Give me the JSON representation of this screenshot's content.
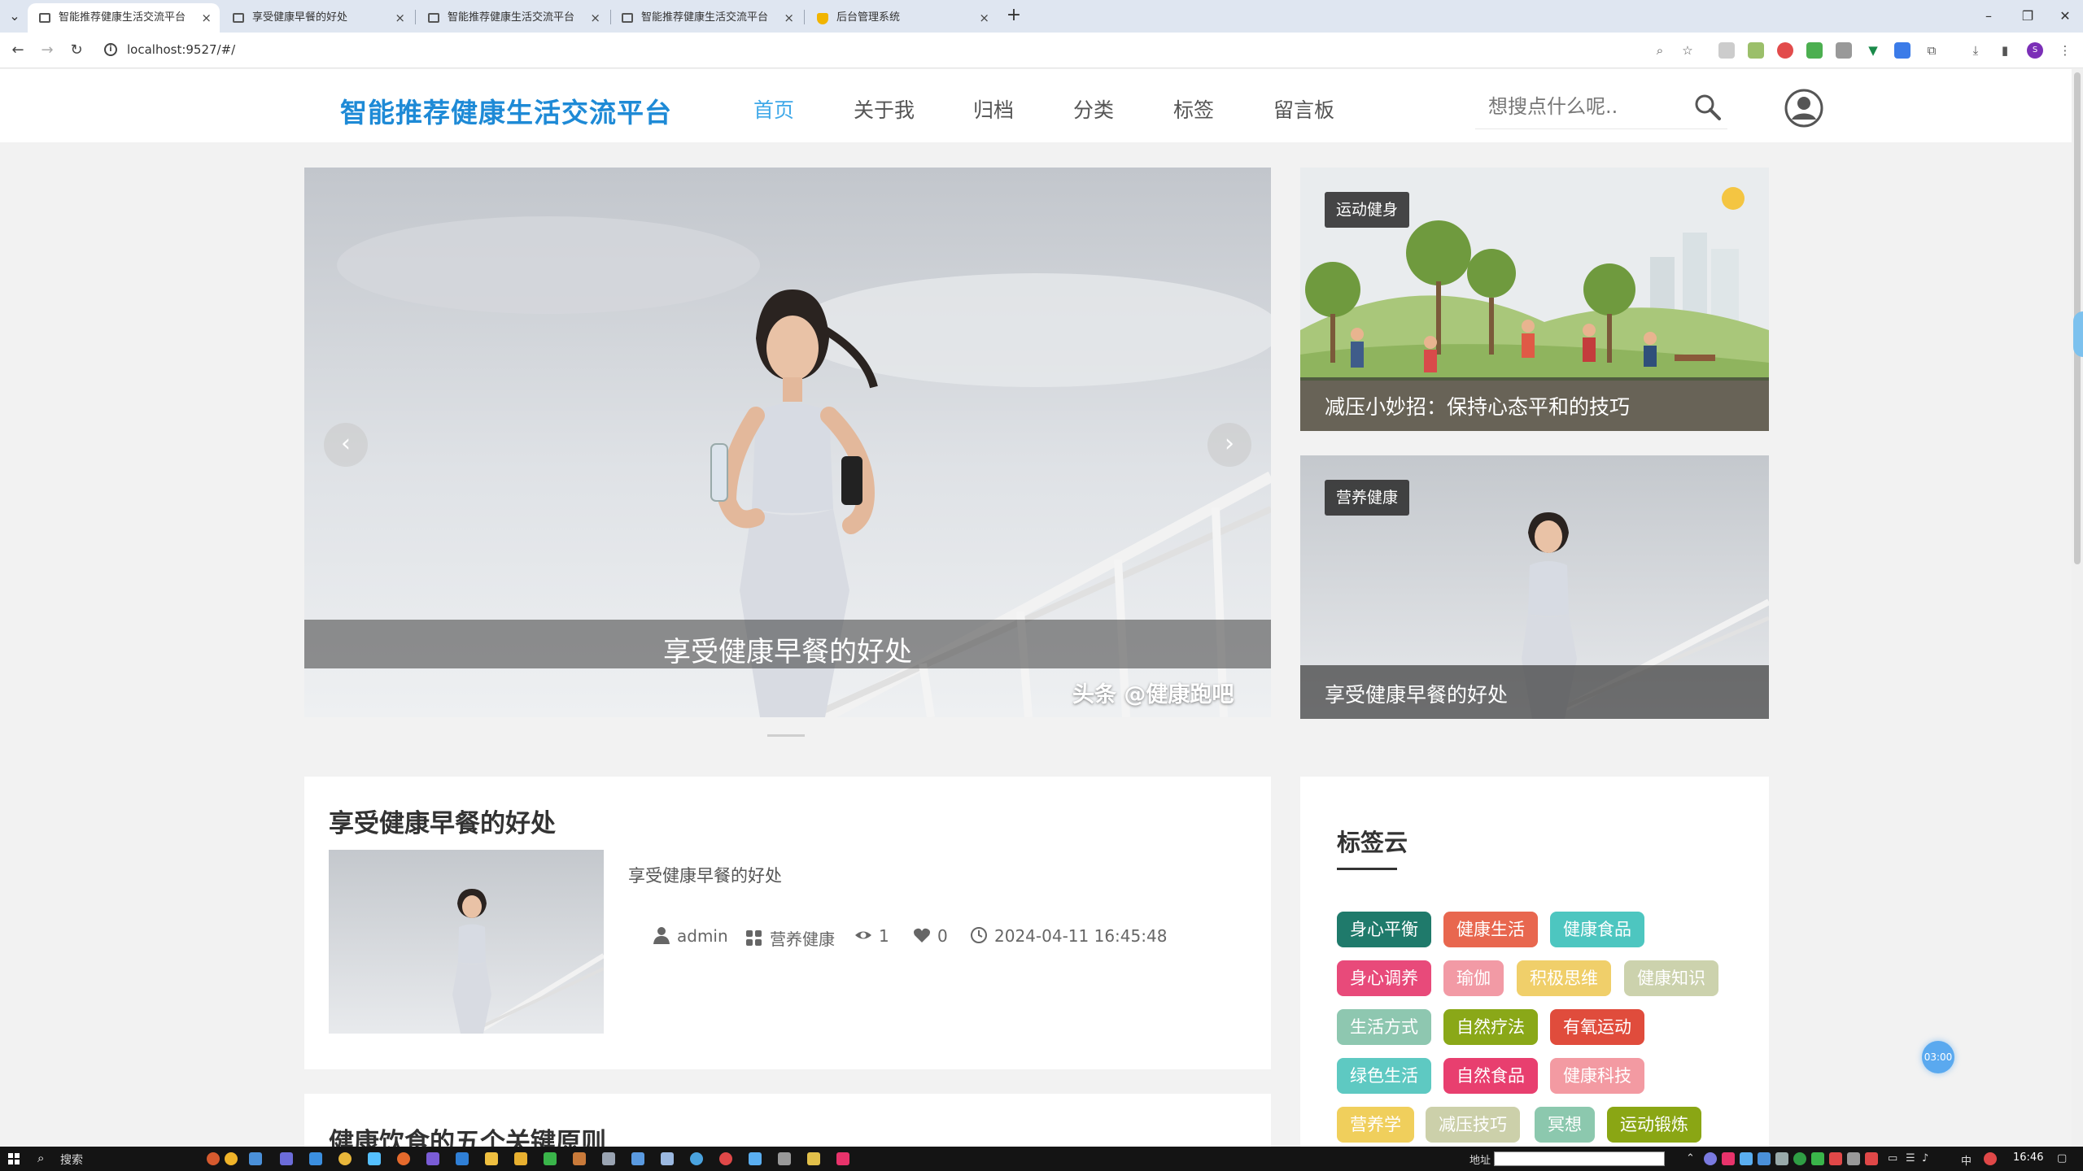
{
  "browser": {
    "tabs": [
      {
        "title": "智能推荐健康生活交流平台",
        "active": true
      },
      {
        "title": "享受健康早餐的好处",
        "active": false
      },
      {
        "title": "智能推荐健康生活交流平台",
        "active": false
      },
      {
        "title": "智能推荐健康生活交流平台",
        "active": false
      },
      {
        "title": "后台管理系统",
        "active": false
      }
    ],
    "url": "localhost:9527/#/",
    "profile_initial": "S"
  },
  "site": {
    "logo": "智能推荐健康生活交流平台",
    "nav": [
      "首页",
      "关于我",
      "归档",
      "分类",
      "标签",
      "留言板"
    ],
    "active_nav": "首页",
    "search_placeholder": "想搜点什么呢.."
  },
  "hero": {
    "caption": "享受健康早餐的好处",
    "watermark": "头条 @健康跑吧",
    "prev_glyph": "‹",
    "next_glyph": "›"
  },
  "side_cards": [
    {
      "category": "运动健身",
      "title": "减压小妙招：保持心态平和的技巧"
    },
    {
      "category": "营养健康",
      "title": "享受健康早餐的好处"
    }
  ],
  "articles": [
    {
      "title": "享受健康早餐的好处",
      "summary": "享受健康早餐的好处",
      "author": "admin",
      "category": "营养健康",
      "views": "1",
      "likes": "0",
      "date": "2024-04-11 16:45:48"
    },
    {
      "title": "健康饮食的五个关键原则"
    }
  ],
  "tag_cloud": {
    "title": "标签云",
    "tags": [
      {
        "label": "身心平衡",
        "color": "#1f7a6b"
      },
      {
        "label": "健康生活",
        "color": "#e8674f"
      },
      {
        "label": "健康食品",
        "color": "#4dc6c0"
      },
      {
        "label": "身心调养",
        "color": "#e84a7a"
      },
      {
        "label": "瑜伽",
        "color": "#f29aa5"
      },
      {
        "label": "积极思维",
        "color": "#f0cf6a"
      },
      {
        "label": "健康知识",
        "color": "#ccd2ad"
      },
      {
        "label": "生活方式",
        "color": "#8ec7b0"
      },
      {
        "label": "自然疗法",
        "color": "#8aa818"
      },
      {
        "label": "有氧运动",
        "color": "#e04c3c"
      },
      {
        "label": "绿色生活",
        "color": "#5ec9c2"
      },
      {
        "label": "自然食品",
        "color": "#e83f6f"
      },
      {
        "label": "健康科技",
        "color": "#f39aa2"
      },
      {
        "label": "营养学",
        "color": "#f0cf5c"
      },
      {
        "label": "减压技巧",
        "color": "#ccd0aa"
      },
      {
        "label": "冥想",
        "color": "#8cc8ae"
      },
      {
        "label": "运动锻炼",
        "color": "#8aa614"
      }
    ]
  },
  "float_timer": "03:00",
  "taskbar": {
    "search_label": "搜索",
    "address_label": "地址",
    "ime": "中",
    "clock": "16:46"
  }
}
